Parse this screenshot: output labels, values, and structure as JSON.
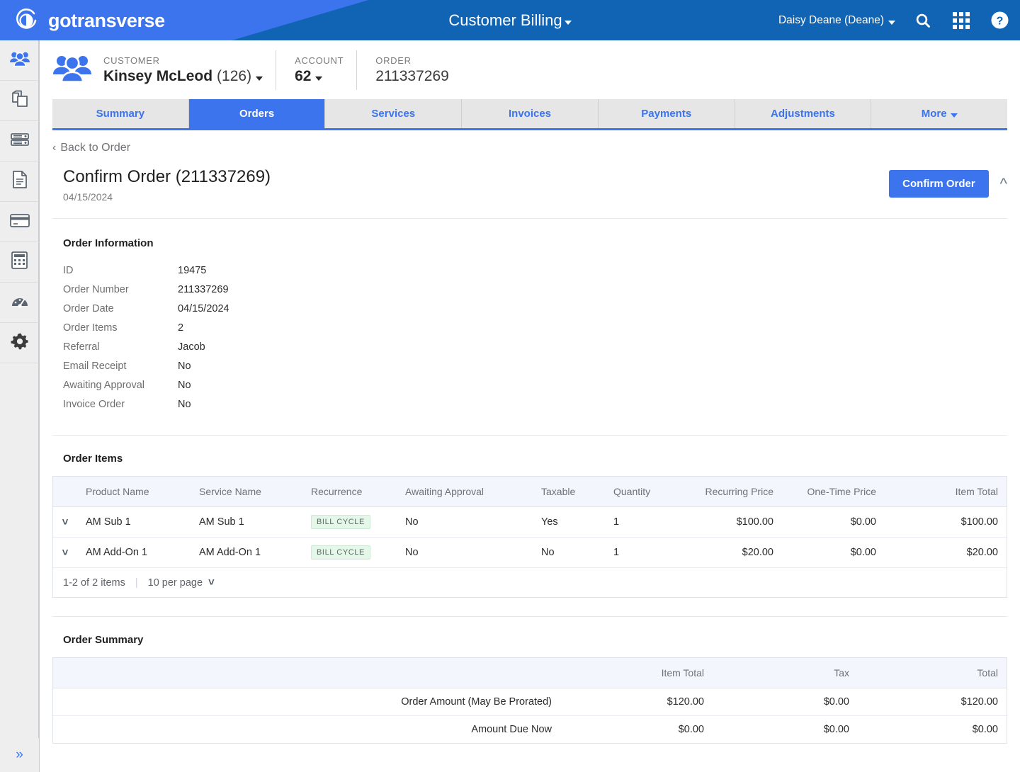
{
  "topbar": {
    "brand": "gotransverse",
    "brand_logo_icon": "circle-swirl-logo-icon",
    "app_title": "Customer Billing",
    "user_menu": "Daisy Deane (Deane)",
    "search_icon": "search-icon",
    "apps_icon": "grid-apps-icon",
    "help_icon": "help-circle-icon",
    "bg_color": "#1164b4",
    "accent_color": "#3b74ed"
  },
  "sidebar": {
    "items": [
      {
        "icon": "customers-people-icon",
        "active": true
      },
      {
        "icon": "copy-pages-icon",
        "active": false
      },
      {
        "icon": "server-stack-icon",
        "active": false
      },
      {
        "icon": "document-icon",
        "active": false
      },
      {
        "icon": "credit-card-icon",
        "active": false
      },
      {
        "icon": "calculator-icon",
        "active": false
      },
      {
        "icon": "gauge-dashboard-icon",
        "active": false
      },
      {
        "icon": "settings-gear-icon",
        "active": false
      }
    ],
    "collapse_icon": "»"
  },
  "context": {
    "customer_label": "CUSTOMER",
    "customer_value": "Kinsey McLeod",
    "customer_id": "(126)",
    "account_label": "ACCOUNT",
    "account_value": "62",
    "order_label": "ORDER",
    "order_value": "211337269"
  },
  "tabs": [
    {
      "label": "Summary",
      "active": false,
      "caret": false
    },
    {
      "label": "Orders",
      "active": true,
      "caret": false
    },
    {
      "label": "Services",
      "active": false,
      "caret": false
    },
    {
      "label": "Invoices",
      "active": false,
      "caret": false
    },
    {
      "label": "Payments",
      "active": false,
      "caret": false
    },
    {
      "label": "Adjustments",
      "active": false,
      "caret": false
    },
    {
      "label": "More",
      "active": false,
      "caret": true
    }
  ],
  "back_link": "Back to Order",
  "page": {
    "title": "Confirm Order (211337269)",
    "subtitle": "04/15/2024",
    "confirm_button": "Confirm Order",
    "collapse_icon": "chevron-up-icon"
  },
  "order_information": {
    "title": "Order Information",
    "rows": [
      {
        "key": "ID",
        "value": "19475"
      },
      {
        "key": "Order Number",
        "value": "211337269"
      },
      {
        "key": "Order Date",
        "value": "04/15/2024"
      },
      {
        "key": "Order Items",
        "value": "2"
      },
      {
        "key": "Referral",
        "value": "Jacob"
      },
      {
        "key": "Email Receipt",
        "value": "No"
      },
      {
        "key": "Awaiting Approval",
        "value": "No"
      },
      {
        "key": "Invoice Order",
        "value": "No"
      }
    ]
  },
  "order_items": {
    "title": "Order Items",
    "columns": [
      "Product Name",
      "Service Name",
      "Recurrence",
      "Awaiting Approval",
      "Taxable",
      "Quantity",
      "Recurring Price",
      "One-Time Price",
      "Item Total"
    ],
    "rows": [
      {
        "product_name": "AM Sub 1",
        "service_name": "AM Sub 1",
        "recurrence": "BILL CYCLE",
        "awaiting_approval": "No",
        "taxable": "Yes",
        "quantity": "1",
        "recurring_price": "$100.00",
        "one_time_price": "$0.00",
        "item_total": "$100.00"
      },
      {
        "product_name": "AM Add-On 1",
        "service_name": "AM Add-On 1",
        "recurrence": "BILL CYCLE",
        "awaiting_approval": "No",
        "taxable": "No",
        "quantity": "1",
        "recurring_price": "$20.00",
        "one_time_price": "$0.00",
        "item_total": "$20.00"
      }
    ],
    "pagination_count": "1-2 of 2 items",
    "per_page": "10 per page",
    "badge_bg": "#e4f7e8"
  },
  "order_summary": {
    "title": "Order Summary",
    "columns": [
      "",
      "Item Total",
      "Tax",
      "Total"
    ],
    "rows": [
      {
        "label": "Order Amount (May Be Prorated)",
        "item_total": "$120.00",
        "tax": "$0.00",
        "total": "$120.00"
      },
      {
        "label": "Amount Due Now",
        "item_total": "$0.00",
        "tax": "$0.00",
        "total": "$0.00"
      }
    ]
  }
}
